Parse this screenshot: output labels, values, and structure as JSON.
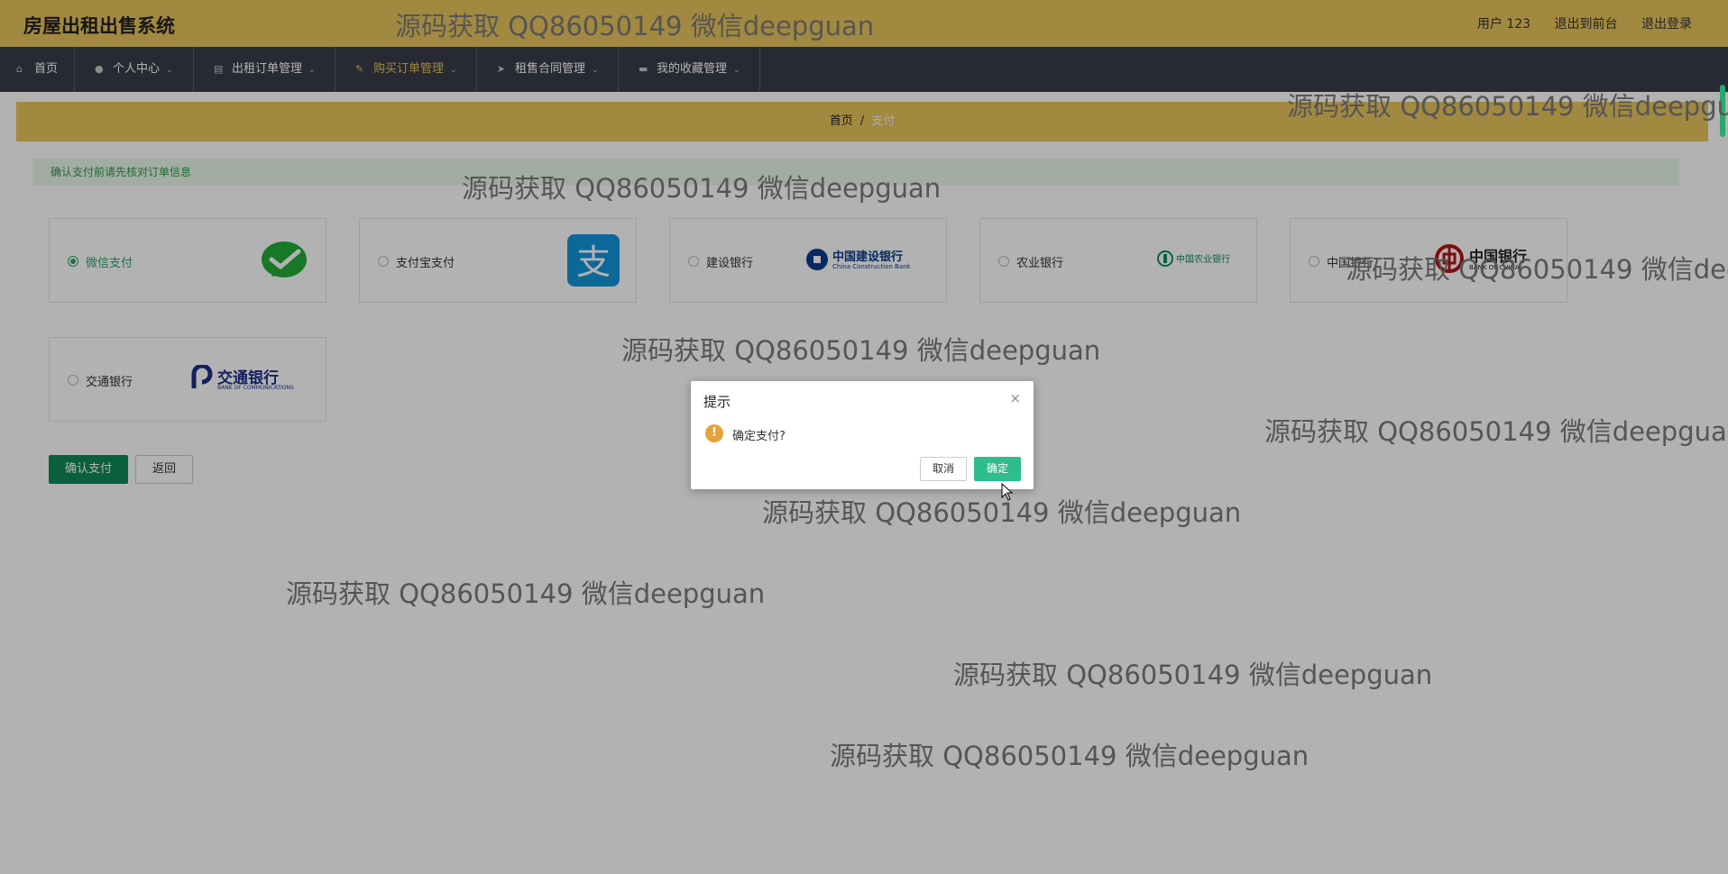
{
  "app": {
    "title": "房屋出租出售系统"
  },
  "top_links": {
    "user": "用户 123",
    "frontend": "退出到前台",
    "logout": "退出登录"
  },
  "nav": {
    "items": [
      {
        "label": "首页",
        "icon": "home-icon",
        "has_caret": false
      },
      {
        "label": "个人中心",
        "icon": "user-icon",
        "has_caret": true
      },
      {
        "label": "出租订单管理",
        "icon": "bank-icon",
        "has_caret": true
      },
      {
        "label": "购买订单管理",
        "icon": "edit-icon",
        "has_caret": true,
        "active": true
      },
      {
        "label": "租售合同管理",
        "icon": "send-icon",
        "has_caret": true
      },
      {
        "label": "我的收藏管理",
        "icon": "monitor-icon",
        "has_caret": true
      }
    ]
  },
  "breadcrumb": {
    "home": "首页",
    "sep": "/",
    "current": "支付"
  },
  "notice": "确认支付前请先核对订单信息",
  "payment_methods": [
    {
      "label": "微信支付",
      "logo": "wechat-pay-logo",
      "selected": true
    },
    {
      "label": "支付宝支付",
      "logo": "alipay-logo"
    },
    {
      "label": "建设银行",
      "logo": "ccb-logo",
      "logo_text": "中国建设银行",
      "logo_sub": "China Construction Bank"
    },
    {
      "label": "农业银行",
      "logo": "abc-logo",
      "logo_text": "中国农业银行"
    },
    {
      "label": "中国银行",
      "logo": "boc-logo",
      "logo_text": "中国银行",
      "logo_sub": "BANK OF CHINA"
    },
    {
      "label": "交通银行",
      "logo": "bocom-logo",
      "logo_text": "交通银行",
      "logo_sub": "BANK OF COMMUNICATIONS"
    }
  ],
  "buttons": {
    "confirm_pay": "确认支付",
    "back": "返回"
  },
  "dialog": {
    "title": "提示",
    "close": "×",
    "icon": "warning-icon",
    "message": "确定支付?",
    "cancel": "取消",
    "ok": "确定"
  },
  "watermark": "源码获取 QQ86050149 微信deepguan",
  "colors": {
    "header": "#e8c55c",
    "nav": "#393d49",
    "primary": "#0f8a5a",
    "dialog_ok": "#2fbd8e",
    "warning": "#e6a23c"
  }
}
